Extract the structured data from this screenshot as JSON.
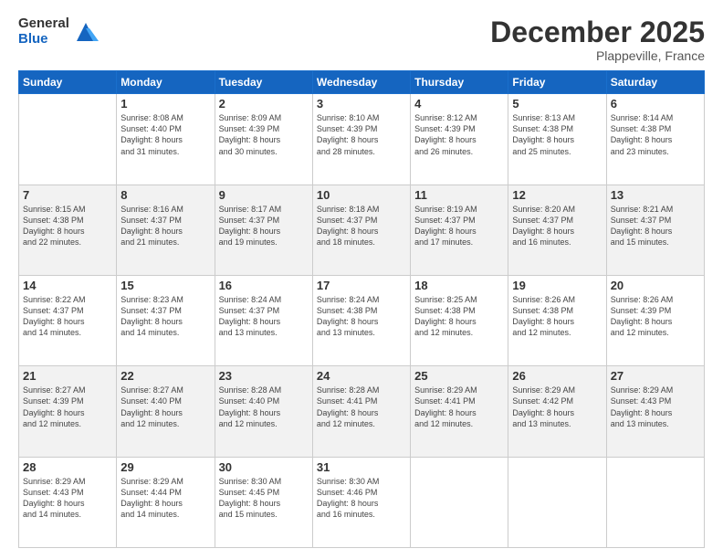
{
  "logo": {
    "general": "General",
    "blue": "Blue"
  },
  "header": {
    "month": "December 2025",
    "location": "Plappeville, France"
  },
  "days": [
    "Sunday",
    "Monday",
    "Tuesday",
    "Wednesday",
    "Thursday",
    "Friday",
    "Saturday"
  ],
  "weeks": [
    [
      {
        "num": "",
        "info": ""
      },
      {
        "num": "1",
        "info": "Sunrise: 8:08 AM\nSunset: 4:40 PM\nDaylight: 8 hours\nand 31 minutes."
      },
      {
        "num": "2",
        "info": "Sunrise: 8:09 AM\nSunset: 4:39 PM\nDaylight: 8 hours\nand 30 minutes."
      },
      {
        "num": "3",
        "info": "Sunrise: 8:10 AM\nSunset: 4:39 PM\nDaylight: 8 hours\nand 28 minutes."
      },
      {
        "num": "4",
        "info": "Sunrise: 8:12 AM\nSunset: 4:39 PM\nDaylight: 8 hours\nand 26 minutes."
      },
      {
        "num": "5",
        "info": "Sunrise: 8:13 AM\nSunset: 4:38 PM\nDaylight: 8 hours\nand 25 minutes."
      },
      {
        "num": "6",
        "info": "Sunrise: 8:14 AM\nSunset: 4:38 PM\nDaylight: 8 hours\nand 23 minutes."
      }
    ],
    [
      {
        "num": "7",
        "info": "Sunrise: 8:15 AM\nSunset: 4:38 PM\nDaylight: 8 hours\nand 22 minutes."
      },
      {
        "num": "8",
        "info": "Sunrise: 8:16 AM\nSunset: 4:37 PM\nDaylight: 8 hours\nand 21 minutes."
      },
      {
        "num": "9",
        "info": "Sunrise: 8:17 AM\nSunset: 4:37 PM\nDaylight: 8 hours\nand 19 minutes."
      },
      {
        "num": "10",
        "info": "Sunrise: 8:18 AM\nSunset: 4:37 PM\nDaylight: 8 hours\nand 18 minutes."
      },
      {
        "num": "11",
        "info": "Sunrise: 8:19 AM\nSunset: 4:37 PM\nDaylight: 8 hours\nand 17 minutes."
      },
      {
        "num": "12",
        "info": "Sunrise: 8:20 AM\nSunset: 4:37 PM\nDaylight: 8 hours\nand 16 minutes."
      },
      {
        "num": "13",
        "info": "Sunrise: 8:21 AM\nSunset: 4:37 PM\nDaylight: 8 hours\nand 15 minutes."
      }
    ],
    [
      {
        "num": "14",
        "info": "Sunrise: 8:22 AM\nSunset: 4:37 PM\nDaylight: 8 hours\nand 14 minutes."
      },
      {
        "num": "15",
        "info": "Sunrise: 8:23 AM\nSunset: 4:37 PM\nDaylight: 8 hours\nand 14 minutes."
      },
      {
        "num": "16",
        "info": "Sunrise: 8:24 AM\nSunset: 4:37 PM\nDaylight: 8 hours\nand 13 minutes."
      },
      {
        "num": "17",
        "info": "Sunrise: 8:24 AM\nSunset: 4:38 PM\nDaylight: 8 hours\nand 13 minutes."
      },
      {
        "num": "18",
        "info": "Sunrise: 8:25 AM\nSunset: 4:38 PM\nDaylight: 8 hours\nand 12 minutes."
      },
      {
        "num": "19",
        "info": "Sunrise: 8:26 AM\nSunset: 4:38 PM\nDaylight: 8 hours\nand 12 minutes."
      },
      {
        "num": "20",
        "info": "Sunrise: 8:26 AM\nSunset: 4:39 PM\nDaylight: 8 hours\nand 12 minutes."
      }
    ],
    [
      {
        "num": "21",
        "info": "Sunrise: 8:27 AM\nSunset: 4:39 PM\nDaylight: 8 hours\nand 12 minutes."
      },
      {
        "num": "22",
        "info": "Sunrise: 8:27 AM\nSunset: 4:40 PM\nDaylight: 8 hours\nand 12 minutes."
      },
      {
        "num": "23",
        "info": "Sunrise: 8:28 AM\nSunset: 4:40 PM\nDaylight: 8 hours\nand 12 minutes."
      },
      {
        "num": "24",
        "info": "Sunrise: 8:28 AM\nSunset: 4:41 PM\nDaylight: 8 hours\nand 12 minutes."
      },
      {
        "num": "25",
        "info": "Sunrise: 8:29 AM\nSunset: 4:41 PM\nDaylight: 8 hours\nand 12 minutes."
      },
      {
        "num": "26",
        "info": "Sunrise: 8:29 AM\nSunset: 4:42 PM\nDaylight: 8 hours\nand 13 minutes."
      },
      {
        "num": "27",
        "info": "Sunrise: 8:29 AM\nSunset: 4:43 PM\nDaylight: 8 hours\nand 13 minutes."
      }
    ],
    [
      {
        "num": "28",
        "info": "Sunrise: 8:29 AM\nSunset: 4:43 PM\nDaylight: 8 hours\nand 14 minutes."
      },
      {
        "num": "29",
        "info": "Sunrise: 8:29 AM\nSunset: 4:44 PM\nDaylight: 8 hours\nand 14 minutes."
      },
      {
        "num": "30",
        "info": "Sunrise: 8:30 AM\nSunset: 4:45 PM\nDaylight: 8 hours\nand 15 minutes."
      },
      {
        "num": "31",
        "info": "Sunrise: 8:30 AM\nSunset: 4:46 PM\nDaylight: 8 hours\nand 16 minutes."
      },
      {
        "num": "",
        "info": ""
      },
      {
        "num": "",
        "info": ""
      },
      {
        "num": "",
        "info": ""
      }
    ]
  ]
}
